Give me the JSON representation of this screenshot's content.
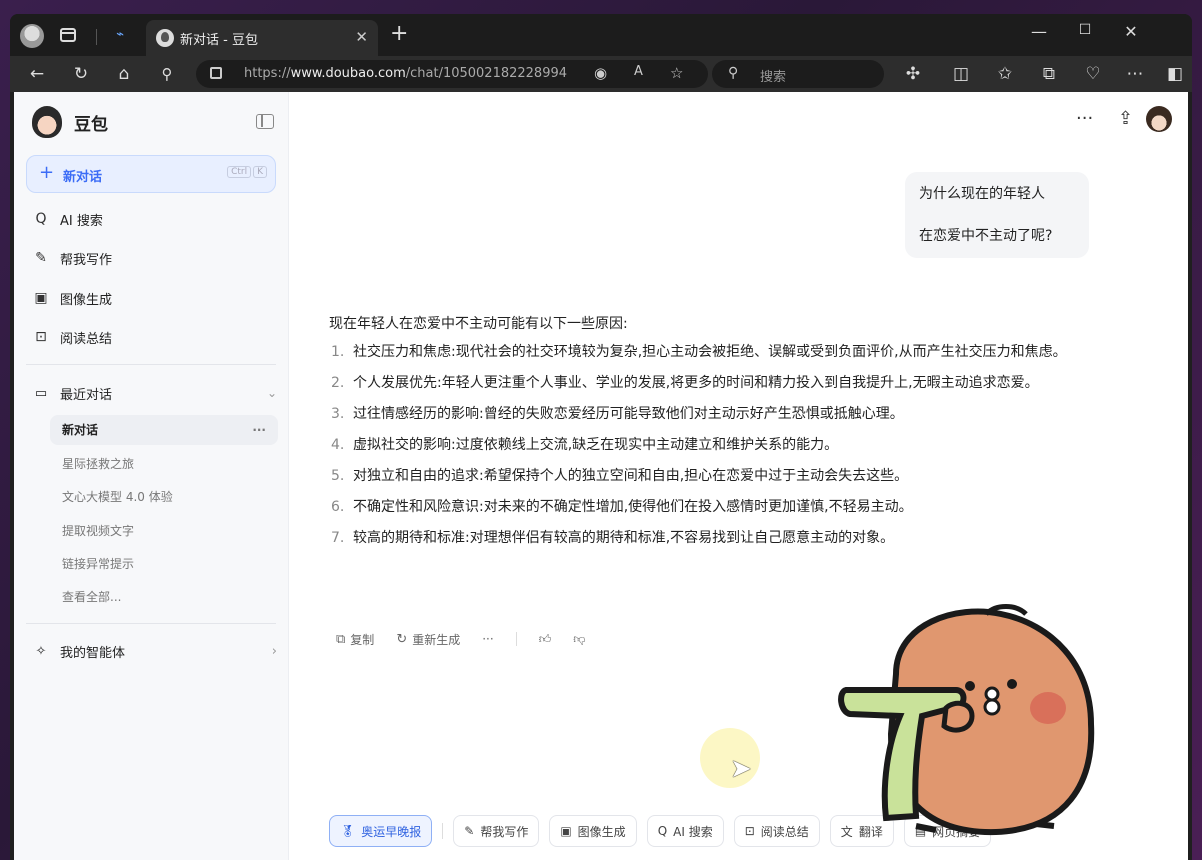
{
  "browser": {
    "tab_title": "新对话 - 豆包",
    "url_prefix": "https://",
    "url_domain": "www.doubao.com",
    "url_path": "/chat/105002182228994",
    "search_placeholder": "搜索"
  },
  "sidebar": {
    "brand": "豆包",
    "new_chat": "新对话",
    "shortcut_keys": [
      "Ctrl",
      "K"
    ],
    "nav": [
      {
        "label": "AI 搜索",
        "icon": "ai-search-icon"
      },
      {
        "label": "帮我写作",
        "icon": "pen-icon"
      },
      {
        "label": "图像生成",
        "icon": "image-icon"
      },
      {
        "label": "阅读总结",
        "icon": "reading-icon"
      }
    ],
    "recent_heading": "最近对话",
    "recent": [
      "新对话",
      "星际拯救之旅",
      "文心大模型 4.0 体验",
      "提取视频文字",
      "链接异常提示",
      "查看全部..."
    ],
    "agents": "我的智能体"
  },
  "conversation": {
    "user_message_line1": "为什么现在的年轻人",
    "user_message_line2": "在恋爱中不主动了呢?",
    "answer_intro": "现在年轻人在恋爱中不主动可能有以下一些原因:",
    "answer_items": [
      "社交压力和焦虑:现代社会的社交环境较为复杂,担心主动会被拒绝、误解或受到负面评价,从而产生社交压力和焦虑。",
      "个人发展优先:年轻人更注重个人事业、学业的发展,将更多的时间和精力投入到自我提升上,无暇主动追求恋爱。",
      "过往情感经历的影响:曾经的失败恋爱经历可能导致他们对主动示好产生恐惧或抵触心理。",
      "虚拟社交的影响:过度依赖线上交流,缺乏在现实中主动建立和维护关系的能力。",
      "对独立和自由的追求:希望保持个人的独立空间和自由,担心在恋爱中过于主动会失去这些。",
      "不确定性和风险意识:对未来的不确定性增加,使得他们在投入感情时更加谨慎,不轻易主动。",
      "较高的期待和标准:对理想伴侣有较高的期待和标准,不容易找到让自己愿意主动的对象。"
    ],
    "actions": {
      "copy": "复制",
      "regenerate": "重新生成"
    }
  },
  "chips": [
    {
      "label": "奥运早晚报",
      "icon": "medal-icon"
    },
    {
      "label": "帮我写作",
      "icon": "pen-icon"
    },
    {
      "label": "图像生成",
      "icon": "image-icon"
    },
    {
      "label": "AI 搜索",
      "icon": "ai-search-icon"
    },
    {
      "label": "阅读总结",
      "icon": "reading-icon"
    },
    {
      "label": "翻译",
      "icon": "translate-icon"
    },
    {
      "label": "网页摘要",
      "icon": "web-summary-icon"
    }
  ],
  "sticker_text": "7"
}
